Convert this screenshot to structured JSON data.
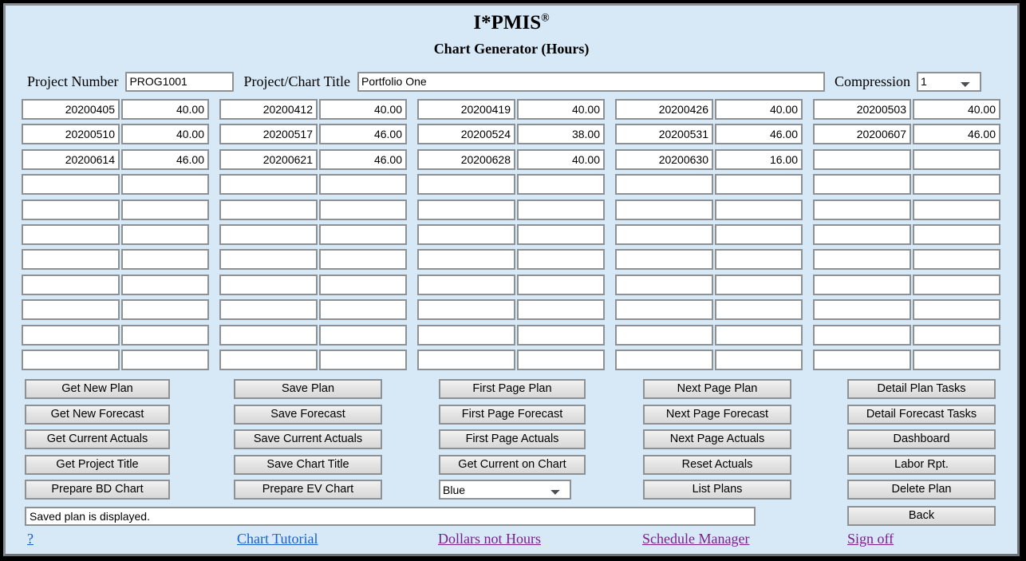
{
  "header": {
    "app_title": "I*PMIS",
    "app_title_sup": "®",
    "sub_title": "Chart Generator (Hours)",
    "project_number_label": "Project Number",
    "project_number_value": "PROG1001",
    "project_title_label": "Project/Chart Title",
    "project_title_value": "Portfolio One",
    "compression_label": "Compression",
    "compression_value": "1",
    "compression_options": [
      "1"
    ]
  },
  "grid": {
    "columns": 10,
    "rows": 11,
    "pairs_per_row": 5,
    "data": [
      [
        "20200405",
        "40.00",
        "20200412",
        "40.00",
        "20200419",
        "40.00",
        "20200426",
        "40.00",
        "20200503",
        "40.00"
      ],
      [
        "20200510",
        "40.00",
        "20200517",
        "46.00",
        "20200524",
        "38.00",
        "20200531",
        "46.00",
        "20200607",
        "46.00"
      ],
      [
        "20200614",
        "46.00",
        "20200621",
        "46.00",
        "20200628",
        "40.00",
        "20200630",
        "16.00",
        "",
        ""
      ],
      [
        "",
        "",
        "",
        "",
        "",
        "",
        "",
        "",
        "",
        ""
      ],
      [
        "",
        "",
        "",
        "",
        "",
        "",
        "",
        "",
        "",
        ""
      ],
      [
        "",
        "",
        "",
        "",
        "",
        "",
        "",
        "",
        "",
        ""
      ],
      [
        "",
        "",
        "",
        "",
        "",
        "",
        "",
        "",
        "",
        ""
      ],
      [
        "",
        "",
        "",
        "",
        "",
        "",
        "",
        "",
        "",
        ""
      ],
      [
        "",
        "",
        "",
        "",
        "",
        "",
        "",
        "",
        "",
        ""
      ],
      [
        "",
        "",
        "",
        "",
        "",
        "",
        "",
        "",
        "",
        ""
      ],
      [
        "",
        "",
        "",
        "",
        "",
        "",
        "",
        "",
        "",
        ""
      ]
    ]
  },
  "buttons": {
    "col1": [
      "Get New Plan",
      "Get New Forecast",
      "Get Current Actuals",
      "Get Project Title",
      "Prepare BD Chart"
    ],
    "col2": [
      "Save Plan",
      "Save Forecast",
      "Save Current Actuals",
      "Save Chart Title",
      "Prepare EV Chart"
    ],
    "col3": [
      "First Page Plan",
      "First Page Forecast",
      "First Page Actuals",
      "Get Current on Chart"
    ],
    "col4": [
      "Next Page Plan",
      "Next Page Forecast",
      "Next Page Actuals",
      "Reset Actuals",
      "List Plans"
    ],
    "col5": [
      "Detail Plan Tasks",
      "Detail Forecast Tasks",
      "Dashboard",
      "Labor Rpt.",
      "Delete Plan"
    ],
    "back": "Back"
  },
  "chart_color": {
    "value": "Blue",
    "options": [
      "Blue"
    ]
  },
  "status": {
    "message": "Saved plan is displayed."
  },
  "links": {
    "help": "?",
    "chart_tutorial": "Chart Tutorial",
    "dollars_not_hours": "Dollars not Hours",
    "schedule_manager": "Schedule Manager",
    "sign_off": "Sign off"
  },
  "colors": {
    "page_background": "#d7e9f7",
    "button_face": "#e4e4e4",
    "field_border": "#8d9194",
    "link_unvisited": "#1a5fd0",
    "link_visited": "#7b1f8c",
    "outer_border": "#000000"
  }
}
